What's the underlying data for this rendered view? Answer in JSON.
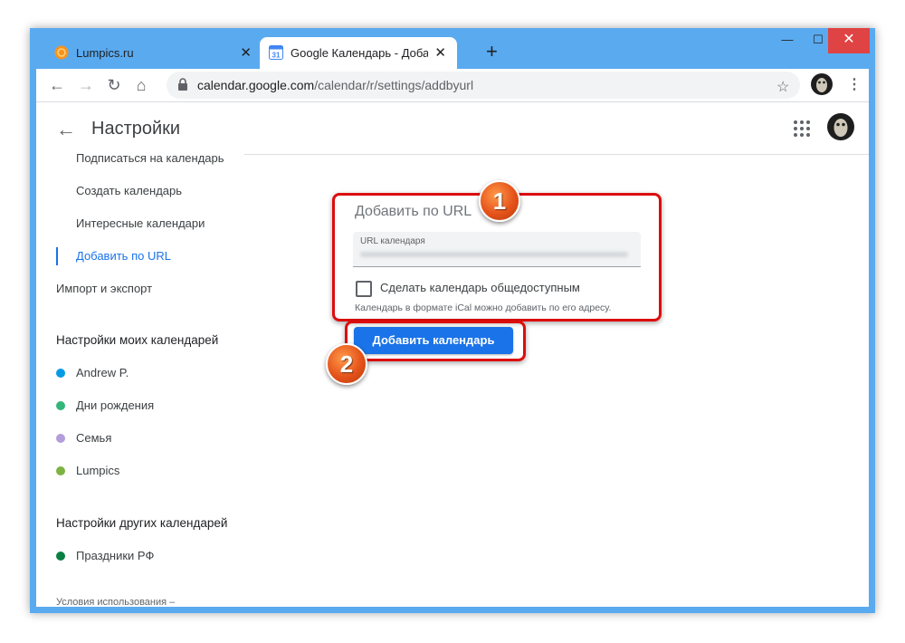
{
  "browser": {
    "tabs": [
      {
        "title": "Lumpics.ru",
        "favicon": "orange-circle-icon",
        "active": false
      },
      {
        "title": "Google Календарь - Добавлени",
        "favicon": "google-calendar-icon",
        "active": true
      }
    ],
    "calendar_favicon_text": "31",
    "new_tab_symbol": "+",
    "tab_close_symbol": "✕",
    "window_controls": {
      "minimize": "—",
      "maximize": "☐",
      "close": "✕"
    },
    "url_host": "calendar.google.com",
    "url_path": "/calendar/r/settings/addbyurl",
    "nav_icons": {
      "back": "←",
      "forward": "→",
      "reload": "↻",
      "home": "⌂",
      "star": "☆",
      "menu": "⋮"
    }
  },
  "header": {
    "back_symbol": "←",
    "title": "Настройки"
  },
  "sidebar": {
    "items": [
      {
        "label": "Подписаться на календарь"
      },
      {
        "label": "Создать календарь"
      },
      {
        "label": "Интересные календари"
      },
      {
        "label": "Добавить по URL",
        "active": true
      }
    ],
    "import_export": "Импорт и экспорт",
    "my_calendars_heading": "Настройки моих календарей",
    "my_calendars": [
      {
        "name": "Andrew P.",
        "color": "#039be5"
      },
      {
        "name": "Дни рождения",
        "color": "#33b679"
      },
      {
        "name": "Семья",
        "color": "#b39ddb"
      },
      {
        "name": "Lumpics",
        "color": "#7cb342"
      }
    ],
    "other_calendars_heading": "Настройки других календарей",
    "other_calendars": [
      {
        "name": "Праздники РФ",
        "color": "#0b8043"
      }
    ],
    "terms": "Условия использования –"
  },
  "main": {
    "section_title": "Добавить по URL",
    "url_field_label": "URL календаря",
    "public_checkbox_label": "Сделать календарь общедоступным",
    "public_checkbox_checked": false,
    "helper_text": "Календарь в формате iCal можно добавить по его адресу.",
    "add_button_label": "Добавить календарь"
  },
  "annotations": {
    "badge_1": "1",
    "badge_2": "2",
    "highlight_color": "#dd0d0d",
    "badge_color": "#e5531a"
  },
  "colors": {
    "accent": "#1a73e8",
    "window_frame": "#5aaaf0"
  }
}
